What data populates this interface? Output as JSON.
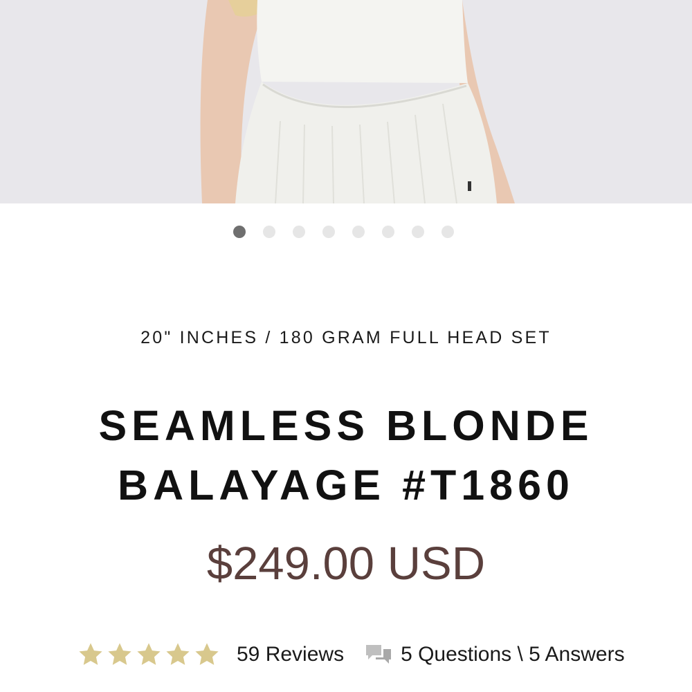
{
  "product": {
    "subtitle": "20\" INCHES / 180 GRAM FULL HEAD SET",
    "title_line1": "SEAMLESS BLONDE",
    "title_line2": "BALAYAGE #T1860",
    "price": "$249.00 USD"
  },
  "gallery": {
    "image_subject": "model wearing white peplum top with blonde hair",
    "slide_count": 8,
    "active_slide": 1
  },
  "rating": {
    "stars": 5,
    "reviews_label": "59 Reviews",
    "qa_label": "5 Questions \\ 5 Answers",
    "star_color": "#d8c88d",
    "icon": "chat-bubbles-icon"
  },
  "colors": {
    "price": "#5a3f3c",
    "dot_active": "#6f6f6f",
    "dot_inactive": "#e6e6e6"
  }
}
